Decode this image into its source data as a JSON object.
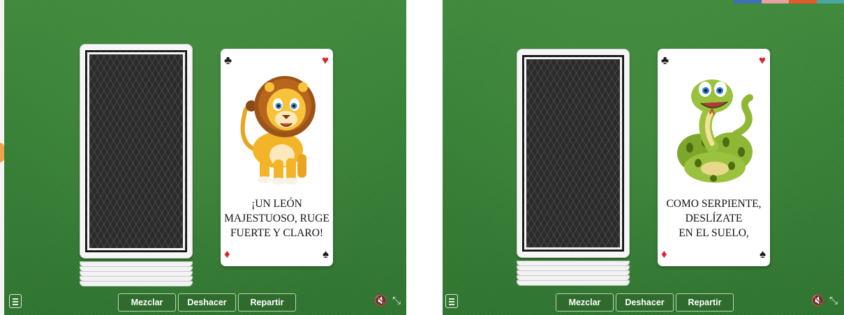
{
  "toolbar": {
    "shuffle_label": "Mezclar",
    "undo_label": "Deshacer",
    "deal_label": "Repartir"
  },
  "cards": [
    {
      "animal": "lion",
      "verse": [
        "¡UN LEÓN",
        "MAJESTUOSO, RUGE",
        "FUERTE Y CLARO!"
      ]
    },
    {
      "animal": "snake",
      "verse": [
        "COMO SERPIENTE,",
        "DESLÍZATE",
        "EN EL SUELO,"
      ]
    }
  ],
  "suits": {
    "top_left": "♣",
    "top_right": "♥",
    "bottom_left": "♦",
    "bottom_right": "♠"
  },
  "icons": {
    "menu": "menu-icon",
    "sound": "mute-icon",
    "fullscreen": "exit-fullscreen-icon"
  },
  "colors": {
    "table_green": "#3a8438",
    "button_green": "#2f6b2c",
    "suit_red": "#d8262c",
    "card_back": "#2b2b2b"
  },
  "glyphs": {
    "mute": "🔇",
    "compress": "⤡"
  }
}
